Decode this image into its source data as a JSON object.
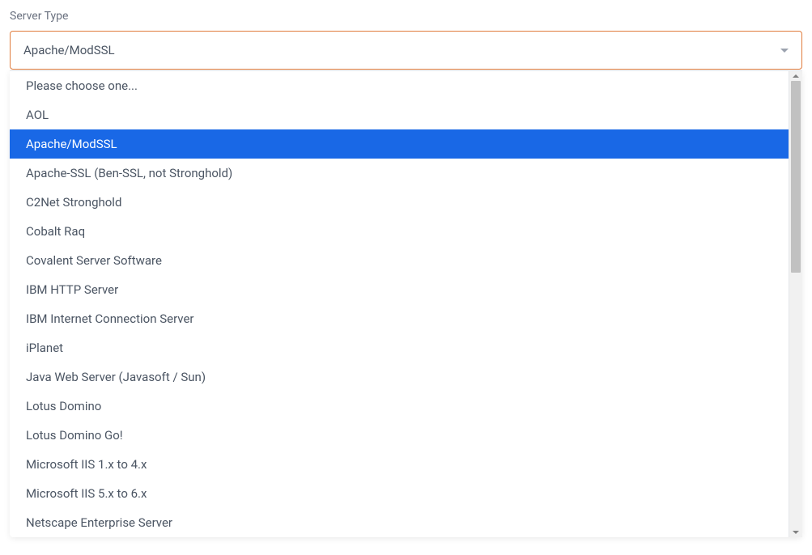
{
  "label": "Server Type",
  "selected": "Apache/ModSSL",
  "options": [
    {
      "label": "Please choose one...",
      "selected": false
    },
    {
      "label": "AOL",
      "selected": false
    },
    {
      "label": "Apache/ModSSL",
      "selected": true
    },
    {
      "label": "Apache-SSL (Ben-SSL, not Stronghold)",
      "selected": false
    },
    {
      "label": "C2Net Stronghold",
      "selected": false
    },
    {
      "label": "Cobalt Raq",
      "selected": false
    },
    {
      "label": "Covalent Server Software",
      "selected": false
    },
    {
      "label": "IBM HTTP Server",
      "selected": false
    },
    {
      "label": "IBM Internet Connection Server",
      "selected": false
    },
    {
      "label": "iPlanet",
      "selected": false
    },
    {
      "label": "Java Web Server (Javasoft / Sun)",
      "selected": false
    },
    {
      "label": "Lotus Domino",
      "selected": false
    },
    {
      "label": "Lotus Domino Go!",
      "selected": false
    },
    {
      "label": "Microsoft IIS 1.x to 4.x",
      "selected": false
    },
    {
      "label": "Microsoft IIS 5.x to 6.x",
      "selected": false
    },
    {
      "label": "Netscape Enterprise Server",
      "selected": false
    }
  ]
}
